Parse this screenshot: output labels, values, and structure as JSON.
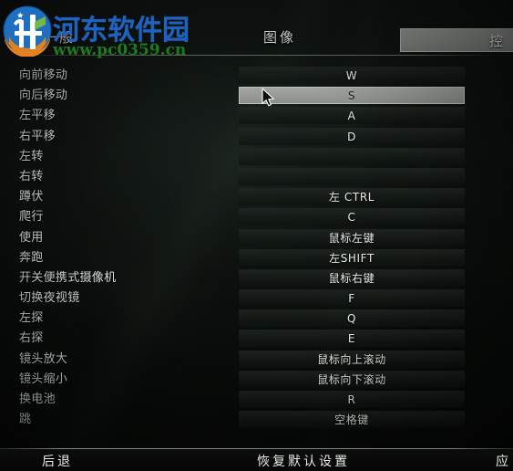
{
  "nav": {
    "tabs": [
      {
        "id": "general",
        "label": "一般",
        "selected": false
      },
      {
        "id": "image",
        "label": "图像",
        "selected": false
      },
      {
        "id": "controls",
        "label": "控",
        "selected": true
      }
    ]
  },
  "controls": {
    "rows": [
      {
        "action": "向前移动",
        "binding": "W",
        "selected": false
      },
      {
        "action": "向后移动",
        "binding": "S",
        "selected": true
      },
      {
        "action": "左平移",
        "binding": "A",
        "selected": false
      },
      {
        "action": "右平移",
        "binding": "D",
        "selected": false
      },
      {
        "action": "左转",
        "binding": "",
        "selected": false
      },
      {
        "action": "右转",
        "binding": "",
        "selected": false
      },
      {
        "action": "蹲伏",
        "binding": "左 CTRL",
        "selected": false
      },
      {
        "action": "爬行",
        "binding": "C",
        "selected": false
      },
      {
        "action": "使用",
        "binding": "鼠标左键",
        "selected": false
      },
      {
        "action": "奔跑",
        "binding": "左SHIFT",
        "selected": false
      },
      {
        "action": "开关便携式摄像机",
        "binding": "鼠标右键",
        "selected": false
      },
      {
        "action": "切换夜视镜",
        "binding": "F",
        "selected": false
      },
      {
        "action": "左探",
        "binding": "Q",
        "selected": false
      },
      {
        "action": "右探",
        "binding": "E",
        "selected": false
      },
      {
        "action": "镜头放大",
        "binding": "鼠标向上滚动",
        "selected": false
      },
      {
        "action": "镜头缩小",
        "binding": "鼠标向下滚动",
        "selected": false
      },
      {
        "action": "换电池",
        "binding": "R",
        "selected": false
      },
      {
        "action": "跳",
        "binding": "空格键",
        "selected": false
      }
    ]
  },
  "footer": {
    "back_label": "后退",
    "reset_label": "恢复默认设置",
    "apply_label": "应"
  },
  "watermark": {
    "title": "河东软件园",
    "url": "www.pc0359.cn",
    "title_color": "#1b63c4",
    "url_color": "#1f7a1f"
  },
  "theme": {
    "background": "#0d110f",
    "selected_row": "#969996",
    "text": "#e3e7e2"
  }
}
